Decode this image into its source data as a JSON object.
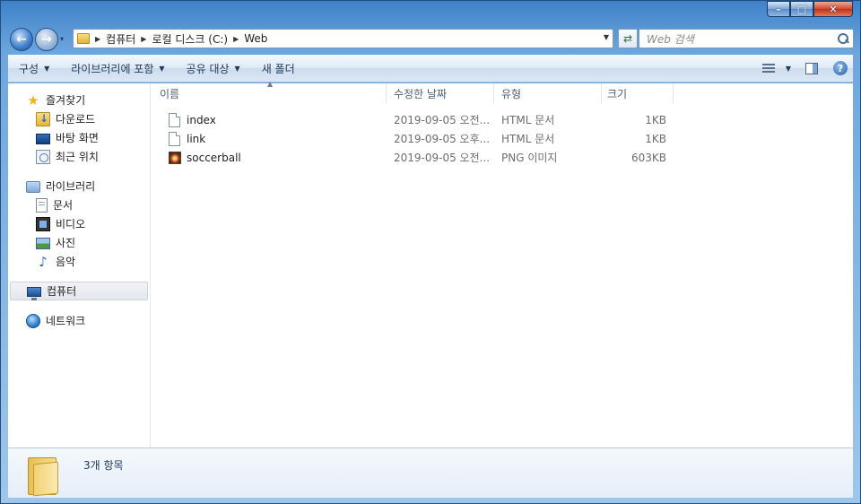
{
  "window": {
    "caption_buttons": {
      "minimize": "–",
      "maximize": "□",
      "close": "✕"
    }
  },
  "nav": {
    "back_glyph": "←",
    "forward_glyph": "→",
    "recent_glyph": "▾"
  },
  "address": {
    "breadcrumb": [
      "컴퓨터",
      "로컬 디스크 (C:)",
      "Web"
    ],
    "separator": "▶",
    "dropdown_glyph": "▼",
    "refresh_glyph": "⇄"
  },
  "search": {
    "placeholder": "Web 검색"
  },
  "toolbar": {
    "organize": "구성",
    "include_in_library": "라이브러리에 포함",
    "share_with": "공유 대상",
    "new_folder": "새 폴더",
    "arrow": "▼",
    "help": "?"
  },
  "sidebar": {
    "favorites": {
      "label": "즐겨찾기",
      "items": [
        "다운로드",
        "바탕 화면",
        "최근 위치"
      ]
    },
    "libraries": {
      "label": "라이브러리",
      "items": [
        "문서",
        "비디오",
        "사진",
        "음악"
      ]
    },
    "computer": "컴퓨터",
    "network": "네트워크"
  },
  "columns": {
    "name": "이름",
    "date": "수정한 날짜",
    "type": "유형",
    "size": "크기",
    "sort_glyph": "▲"
  },
  "files": [
    {
      "name": "index",
      "date": "2019-09-05 오전...",
      "type": "HTML 문서",
      "size": "1KB",
      "icon": "html-file-icon"
    },
    {
      "name": "link",
      "date": "2019-09-05 오후...",
      "type": "HTML 문서",
      "size": "1KB",
      "icon": "html-file-icon"
    },
    {
      "name": "soccerball",
      "date": "2019-09-05 오전...",
      "type": "PNG 이미지",
      "size": "603KB",
      "icon": "png-image-icon"
    }
  ],
  "details": {
    "item_count": "3개 항목"
  }
}
